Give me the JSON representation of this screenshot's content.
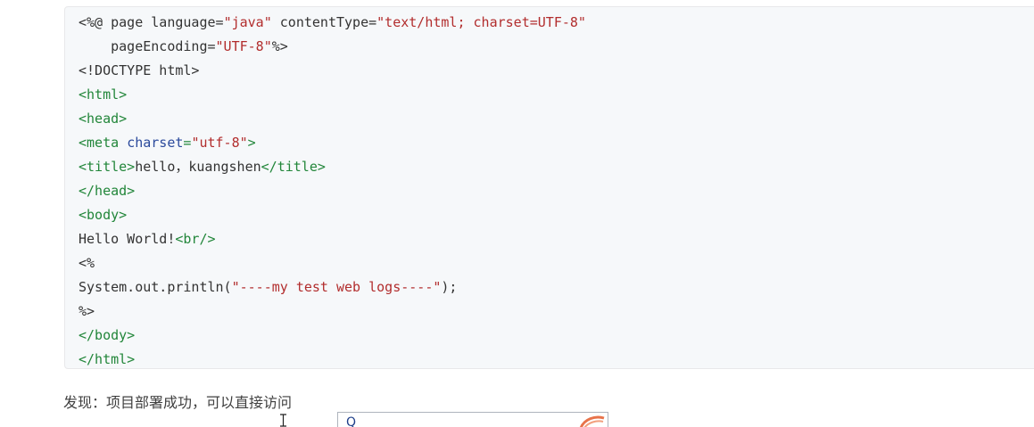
{
  "code_block": {
    "lines": [
      [
        {
          "t": "<%@ page language=",
          "c": "txt"
        },
        {
          "t": "\"java\"",
          "c": "str"
        },
        {
          "t": " contentType=",
          "c": "txt"
        },
        {
          "t": "\"text/html; ",
          "c": "str"
        },
        {
          "t": "charset=UTF-8\"",
          "c": "str"
        }
      ],
      [
        {
          "t": "    pageEncoding=",
          "c": "txt"
        },
        {
          "t": "\"UTF-8\"",
          "c": "str"
        },
        {
          "t": "%>",
          "c": "txt"
        }
      ],
      [
        {
          "t": "<!DOCTYPE html>",
          "c": "txt"
        }
      ],
      [
        {
          "t": "<html>",
          "c": "tag"
        }
      ],
      [
        {
          "t": "<head>",
          "c": "tag"
        }
      ],
      [
        {
          "t": "<meta ",
          "c": "tag"
        },
        {
          "t": "charset",
          "c": "attr"
        },
        {
          "t": "=",
          "c": "tag"
        },
        {
          "t": "\"utf-8\"",
          "c": "str"
        },
        {
          "t": ">",
          "c": "tag"
        }
      ],
      [
        {
          "t": "<title>",
          "c": "tag"
        },
        {
          "t": "hello，kuangshen",
          "c": "txt"
        },
        {
          "t": "</title>",
          "c": "tag"
        }
      ],
      [
        {
          "t": "</head>",
          "c": "tag"
        }
      ],
      [
        {
          "t": "<body>",
          "c": "tag"
        }
      ],
      [
        {
          "t": "Hello World!",
          "c": "txt"
        },
        {
          "t": "<br/>",
          "c": "tag"
        }
      ],
      [
        {
          "t": "<%",
          "c": "txt"
        }
      ],
      [
        {
          "t": "System.out.println(",
          "c": "txt"
        },
        {
          "t": "\"----my test web logs----\"",
          "c": "str"
        },
        {
          "t": ");",
          "c": "txt"
        }
      ],
      [
        {
          "t": "%>",
          "c": "txt"
        }
      ],
      [
        {
          "t": "</body>",
          "c": "tag"
        }
      ],
      [
        {
          "t": "</html>",
          "c": "tag"
        }
      ]
    ]
  },
  "paragraph": {
    "text": "发现：项目部署成功，可以直接访问"
  },
  "popup": {
    "glyph": "Q",
    "icon": "app-logo-icon"
  },
  "cursor": {
    "icon": "text-cursor-icon"
  },
  "colors": {
    "code_background": "#f6f8fa",
    "tag": "#22863a",
    "string": "#b22d2d",
    "attribute": "#2b4a9c",
    "text": "#333333"
  }
}
